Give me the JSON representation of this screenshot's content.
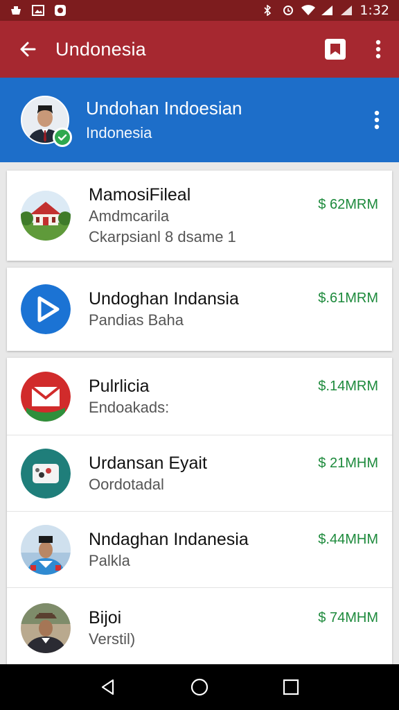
{
  "status_bar": {
    "time": "1:32"
  },
  "app_bar": {
    "title": "Undonesia"
  },
  "profile": {
    "name": "Undohan Indoesian",
    "subtitle": "Indonesia"
  },
  "items": [
    {
      "title": "MamosiFileal",
      "sub1": "Amdmcarila",
      "sub2": "Ckarpsianl 8 dsame 1",
      "price": "$ 62MRM",
      "icon": "building-icon"
    },
    {
      "title": "Undoghan Indansia",
      "sub1": "Pandias Baha",
      "price": "$.61MRM",
      "icon": "play-icon"
    },
    {
      "title": "Pulrlicia",
      "sub1": "Endoakads:",
      "price": "$.14MRM",
      "icon": "mail-icon"
    },
    {
      "title": "Urdansan Eyait",
      "sub1": "Oordotadal",
      "price": "$ 21MHM",
      "icon": "camera-icon"
    },
    {
      "title": "Nndaghan Indanesia",
      "sub1": "Palkla",
      "price": "$.44MHM",
      "icon": "person-avatar"
    },
    {
      "title": "Bijoi",
      "sub1": "Verstil)",
      "price": "$ 74MHM",
      "icon": "person-avatar"
    }
  ]
}
